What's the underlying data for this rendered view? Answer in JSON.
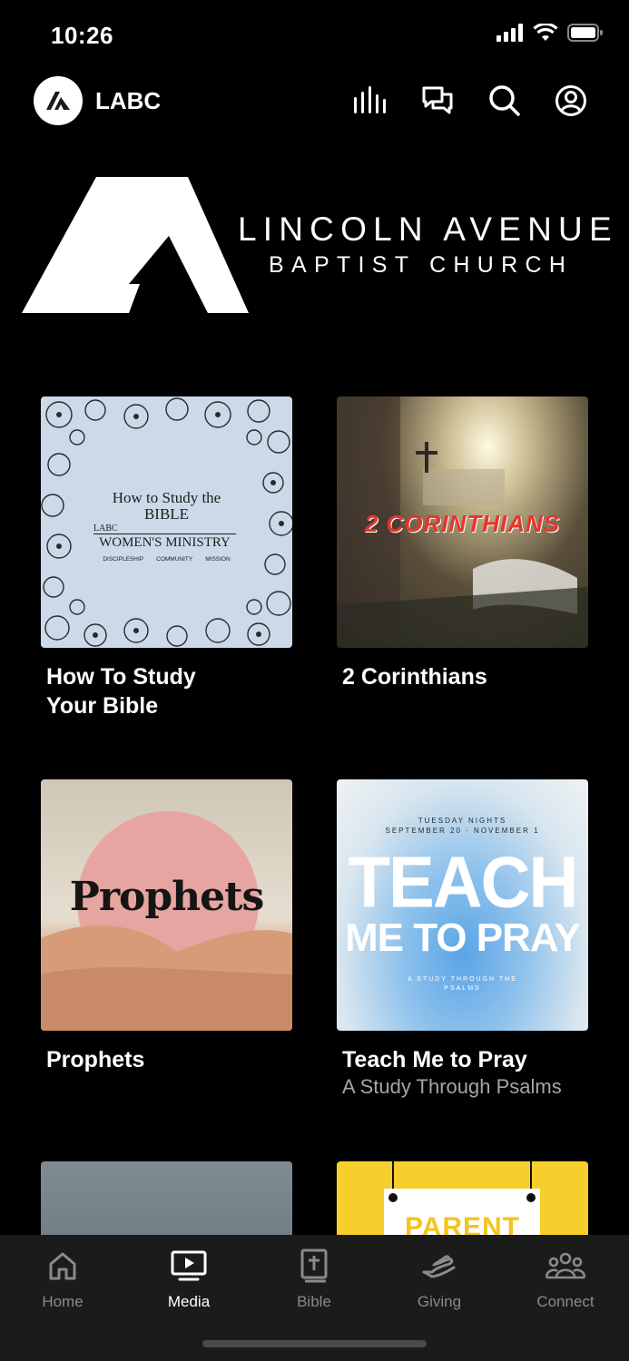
{
  "status": {
    "time": "10:26"
  },
  "header": {
    "app_name": "LABC",
    "logo_text": "LA"
  },
  "banner": {
    "line1": "LINCOLN AVENUE",
    "line2": "BAPTIST CHURCH"
  },
  "cards": [
    {
      "title": "How To Study Your Bible",
      "subtitle": "",
      "art": {
        "line1": "How to Study the",
        "line2": "BIBLE",
        "line3": "LABC",
        "line4": "WOMEN'S MINISTRY",
        "tags": [
          "DISCIPLESHIP",
          "COMMUNITY",
          "MISSION"
        ]
      }
    },
    {
      "title": "2 Corinthians",
      "subtitle": "",
      "art": {
        "text": "2 CORINTHIANS"
      }
    },
    {
      "title": "Prophets",
      "subtitle": "",
      "art": {
        "text": "Prophets"
      }
    },
    {
      "title": "Teach Me to Pray",
      "subtitle": "A Study Through Psalms",
      "art": {
        "top1": "TUESDAY NIGHTS",
        "top2": "SEPTEMBER 20 · NOVEMBER 1",
        "big1": "TEACH",
        "big2": "ME TO PRAY",
        "foot1": "A STUDY THROUGH THE",
        "foot2": "PSALMS"
      }
    },
    {
      "title": "",
      "subtitle": "",
      "art": {}
    },
    {
      "title": "",
      "subtitle": "",
      "art": {
        "text": "PARENT"
      }
    }
  ],
  "tabs": [
    {
      "label": "Home",
      "icon": "home-icon"
    },
    {
      "label": "Media",
      "icon": "media-icon",
      "active": true
    },
    {
      "label": "Bible",
      "icon": "bible-icon"
    },
    {
      "label": "Giving",
      "icon": "giving-icon"
    },
    {
      "label": "Connect",
      "icon": "connect-icon"
    }
  ]
}
